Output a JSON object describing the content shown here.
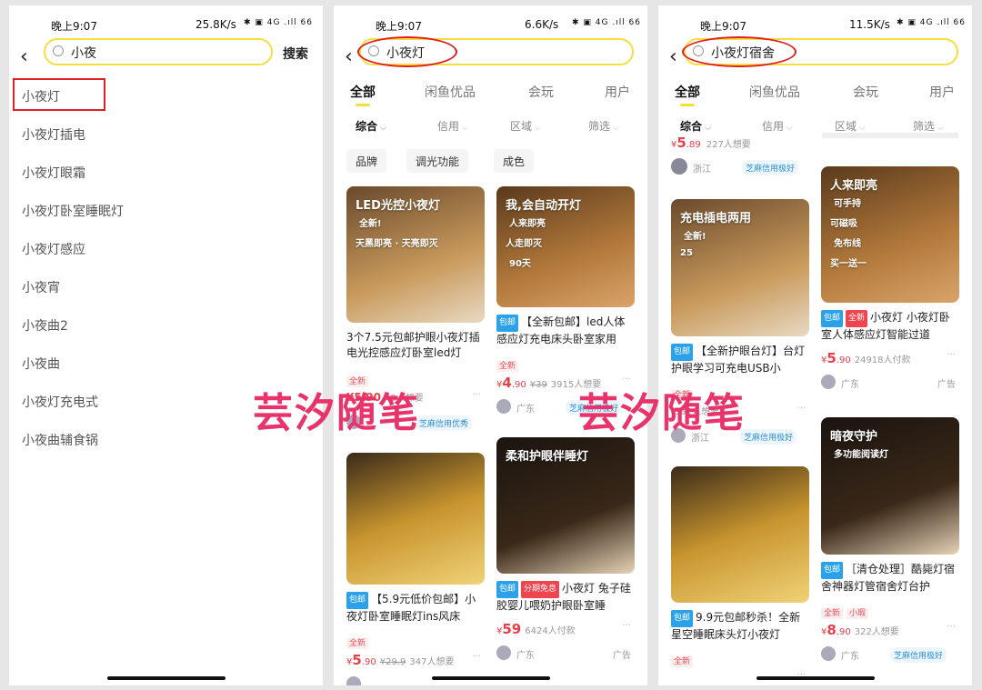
{
  "watermark": "芸汐随笔",
  "colors": {
    "accent": "#f6de3c",
    "highlight": "#e02020",
    "price": "#e8404a",
    "watermark": "#e8336b"
  },
  "panel1": {
    "status": {
      "time": "晚上9:07",
      "speed": "25.8K/s",
      "icons": "✱ ▣ 4G .ıll 66"
    },
    "query": "小夜",
    "search_button": "搜索",
    "suggestions": [
      "小夜灯",
      "小夜灯插电",
      "小夜灯眼霜",
      "小夜灯卧室睡眠灯",
      "小夜灯感应",
      "小夜宵",
      "小夜曲2",
      "小夜曲",
      "小夜灯充电式",
      "小夜曲辅食锅"
    ]
  },
  "panel2": {
    "status": {
      "time": "晚上9:07",
      "speed": "6.6K/s",
      "icons": "✱ ▣ 4G .ıll 66"
    },
    "query": "小夜灯",
    "tabs": [
      "全部",
      "闲鱼优品",
      "会玩",
      "用户"
    ],
    "filters": [
      "综合",
      "信用",
      "区域",
      "筛选"
    ],
    "chips": [
      "品牌",
      "调光功能",
      "成色"
    ],
    "cards": [
      {
        "img": [
          "LED光控小夜灯",
          "全新!",
          "天黑即亮 · 天亮即灭"
        ],
        "tags": [],
        "title": "3个7.5元包邮护眼小夜灯插电光控感应灯卧室led灯",
        "labels": [
          "全新"
        ],
        "price": "¥5.90",
        "meta": "48人想要",
        "loc": "",
        "credit": "芝麻信用优秀"
      },
      {
        "img": [
          "我,会自动开灯",
          "人来即亮",
          "人走即灭",
          "90天"
        ],
        "tags": [
          "包邮"
        ],
        "title": "【全新包邮】led人体感应灯充电床头卧室家用",
        "labels": [
          "全新"
        ],
        "price_int": "4",
        "price_dec": ".90",
        "orig": "¥39",
        "meta": "3915人想要",
        "loc": "广东",
        "credit": "芝麻信用极好"
      },
      {
        "img": [],
        "tags": [
          "包邮"
        ],
        "title": "【5.9元低价包邮】小夜灯卧室睡眠灯ins风床",
        "labels": [
          "全新"
        ],
        "price_int": "5",
        "price_dec": ".90",
        "orig": "¥29.9",
        "meta": "347人想要",
        "loc": "",
        "credit": ""
      },
      {
        "img": [
          "柔和护眼伴睡灯"
        ],
        "tags": [
          "包邮",
          "分期免息"
        ],
        "title": "小夜灯 兔子硅胶婴儿喂奶护眼卧室睡",
        "labels": [],
        "price_int": "59",
        "price_dec": "",
        "orig": "",
        "meta": "6424人付款",
        "loc": "广东",
        "ad": "广告"
      }
    ]
  },
  "panel3": {
    "status": {
      "time": "晚上9:07",
      "speed": "11.5K/s",
      "icons": "✱ ▣ 4G .ıll 66"
    },
    "query": "小夜灯宿舍",
    "tabs": [
      "全部",
      "闲鱼优品",
      "会玩",
      "用户"
    ],
    "filters": [
      "综合",
      "信用",
      "区域",
      "筛选"
    ],
    "partial": {
      "price_int": "5",
      "price_dec": ".89",
      "meta": "227人想要",
      "loc": "浙江",
      "credit": "芝麻信用极好"
    },
    "cards": [
      {
        "img": [
          "充电插电两用",
          "全新!",
          "25"
        ],
        "tags": [
          "包邮"
        ],
        "title": "【全新护眼台灯】台灯护眼学习可充电USB小",
        "labels": [
          "全新"
        ],
        "price_int": "",
        "price_dec": "",
        "orig": "",
        "meta": "591人想要",
        "loc": "浙江",
        "credit": "芝麻信用极好"
      },
      {
        "img": [
          "人来即亮",
          "可手持",
          "可磁吸",
          "免布线",
          "买一送一"
        ],
        "tags": [
          "包邮",
          "全新"
        ],
        "title": "小夜灯 小夜灯卧室人体感应灯智能过道",
        "labels": [],
        "price_int": "5",
        "price_dec": ".90",
        "orig": "",
        "meta": "24918人付款",
        "loc": "广东",
        "ad": "广告"
      },
      {
        "img": [],
        "tags": [
          "包邮"
        ],
        "title": "9.9元包邮秒杀！全新星空睡眠床头灯小夜灯",
        "labels": [
          "全新"
        ],
        "price_int": "",
        "price_dec": "",
        "orig": "",
        "meta": "",
        "loc": "",
        "credit": ""
      },
      {
        "img": [
          "暗夜守护",
          "多功能阅读灯"
        ],
        "tags": [
          "包邮"
        ],
        "title": "［清仓处理］酷毙灯宿舍神器灯管宿舍灯台护",
        "labels": [
          "全新",
          "小瑕"
        ],
        "price_int": "8",
        "price_dec": ".90",
        "orig": "",
        "meta": "322人想要",
        "loc": "广东",
        "credit": "芝麻信用极好"
      }
    ]
  }
}
